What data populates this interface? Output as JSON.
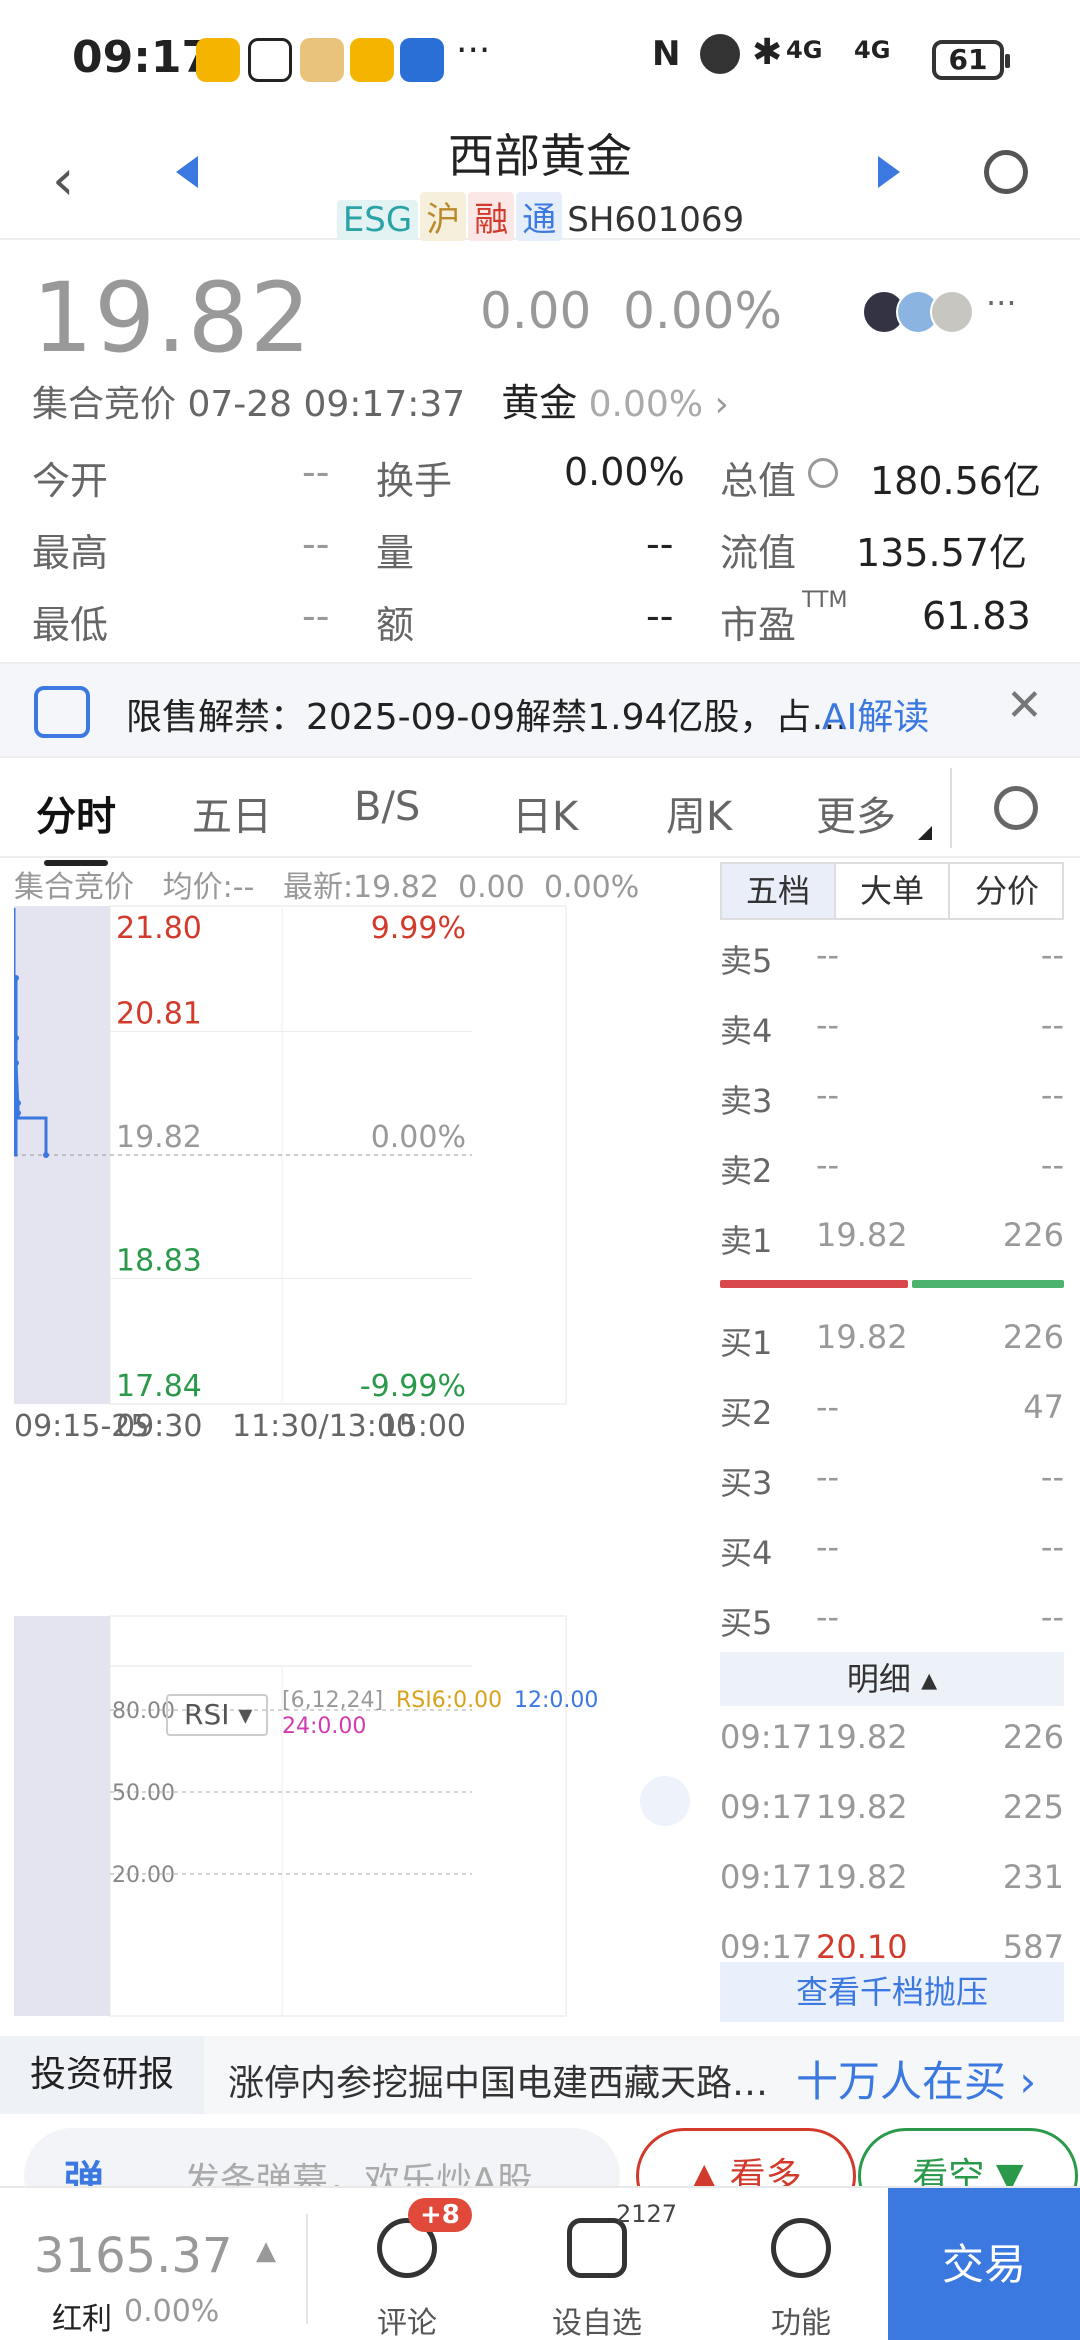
{
  "status_bar": {
    "time": "09:17",
    "network": "4G",
    "battery": "61"
  },
  "header": {
    "title": "西部黄金",
    "tags": [
      "ESG",
      "沪",
      "融",
      "通"
    ],
    "code": "SH601069"
  },
  "quote": {
    "price": "19.82",
    "change": "0.00",
    "change_pct": "0.00%",
    "session": "集合竞价 07-28 09:17:37",
    "sector": "黄金",
    "sector_pct": "0.00%",
    "stats": [
      {
        "label": "今开",
        "value": "--",
        "label2": "换手",
        "value2": "0.00%",
        "label3": "总值",
        "value3": "180.56亿"
      },
      {
        "label": "最高",
        "value": "--",
        "label2": "量",
        "value2": "--",
        "label3": "流值",
        "value3": "135.57亿"
      },
      {
        "label": "最低",
        "value": "--",
        "label2": "额",
        "value2": "--",
        "label3": "市盈",
        "value3": "61.83",
        "label3_sup": "TTM"
      }
    ]
  },
  "notice": {
    "text": "限售解禁：2025-09-09解禁1.94亿股，占…",
    "ai_label": "AI解读"
  },
  "tabs": [
    "分时",
    "五日",
    "B/S",
    "日K",
    "周K",
    "更多"
  ],
  "chart_info": {
    "session": "集合竞价",
    "avg": "均价:--",
    "latest": "最新:19.82",
    "chg": "0.00",
    "pct": "0.00%"
  },
  "chart_data": {
    "type": "line",
    "y_labels_left": [
      "21.80",
      "20.81",
      "19.82",
      "18.83",
      "17.84"
    ],
    "y_labels_right": [
      "9.99%",
      "",
      "0.00%",
      "",
      "-9.99%"
    ],
    "x_labels": [
      "09:15-25",
      "09:30",
      "11:30/13:00",
      "15:00"
    ],
    "ylim": [
      17.84,
      21.8
    ],
    "prev_close": 19.82
  },
  "rsi": {
    "selector": "RSI",
    "params": "[6,12,24]",
    "rsi6": "RSI6:0.00",
    "rsi12": "12:0.00",
    "rsi24": "24:0.00",
    "levels": [
      "80.00",
      "50.00",
      "20.00"
    ]
  },
  "order_book": {
    "tabs": [
      "五档",
      "大单",
      "分价"
    ],
    "sells": [
      {
        "label": "卖5",
        "price": "--",
        "vol": "--"
      },
      {
        "label": "卖4",
        "price": "--",
        "vol": "--"
      },
      {
        "label": "卖3",
        "price": "--",
        "vol": "--"
      },
      {
        "label": "卖2",
        "price": "--",
        "vol": "--"
      },
      {
        "label": "卖1",
        "price": "19.82",
        "vol": "226"
      }
    ],
    "buys": [
      {
        "label": "买1",
        "price": "19.82",
        "vol": "226"
      },
      {
        "label": "买2",
        "price": "--",
        "vol": "47"
      },
      {
        "label": "买3",
        "price": "--",
        "vol": "--"
      },
      {
        "label": "买4",
        "price": "--",
        "vol": "--"
      },
      {
        "label": "买5",
        "price": "--",
        "vol": "--"
      }
    ]
  },
  "details": {
    "header": "明细",
    "rows": [
      {
        "time": "09:17",
        "price": "19.82",
        "vol": "226"
      },
      {
        "time": "09:17",
        "price": "19.82",
        "vol": "225"
      },
      {
        "time": "09:17",
        "price": "19.82",
        "vol": "231"
      },
      {
        "time": "09:17",
        "price": "20.10",
        "vol": "587"
      }
    ],
    "view_depth": "查看千档抛压"
  },
  "research": {
    "label": "投资研报",
    "headline": "涨停内参挖掘中国电建西藏天路…",
    "buyers": "十万人在买"
  },
  "comment": {
    "danmu_icon": "弹",
    "placeholder": "发条弹幕，欢乐炒A股",
    "bull": "看多",
    "bear": "看空"
  },
  "bottom": {
    "index_value": "3165.37",
    "index_name": "红利",
    "index_pct": "0.00%",
    "comments_label": "评论",
    "comments_badge": "+8",
    "watch_label": "设自选",
    "watch_count": "2127",
    "func_label": "功能",
    "trade_label": "交易"
  }
}
